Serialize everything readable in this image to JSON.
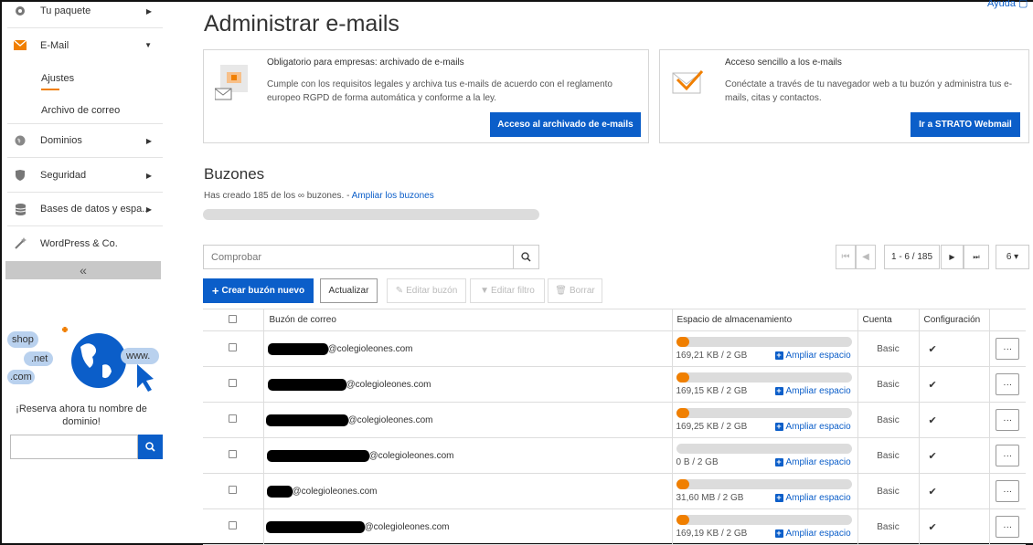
{
  "sidebar": {
    "items": [
      {
        "label": "Tu paquete",
        "icon": "package-icon"
      },
      {
        "label": "E-Mail",
        "icon": "envelope-icon"
      },
      {
        "label": "Dominios",
        "icon": "globe-icon"
      },
      {
        "label": "Seguridad",
        "icon": "shield-icon"
      },
      {
        "label": "Bases de datos y espa...",
        "icon": "database-icon"
      },
      {
        "label": "WordPress & Co.",
        "icon": "wand-icon"
      }
    ],
    "subitems": [
      "Ajustes",
      "Archivo de correo"
    ],
    "collapse_label": "«",
    "promo": {
      "text": "¡Reserva ahora tu nombre de dominio!",
      "bubble_1": "shop",
      "bubble_2": ".net",
      "bubble_3": ".com",
      "bubble_4": "www."
    }
  },
  "header": {
    "title": "Administrar e-mails",
    "help": "Ayuda"
  },
  "cards": [
    {
      "title": "Obligatorio para empresas: archivado de e-mails",
      "text": "Cumple con los requisitos legales y archiva tus e-mails de acuerdo con el reglamento europeo RGPD de forma automática y conforme a la ley.",
      "button": "Acceso al archivado de e-mails"
    },
    {
      "title": "Acceso sencillo a los e-mails",
      "text": "Conéctate a través de tu navegador web a tu buzón y administra tus e-mails, citas y contactos.",
      "button": "Ir a STRATO Webmail"
    }
  ],
  "mailboxes": {
    "title": "Buzones",
    "info": "Has creado 185 de los ∞ buzones. - ",
    "info_link": "Ampliar los buzones",
    "search_placeholder": "Comprobar",
    "pagination": {
      "first": "⏮",
      "prev": "◀",
      "range": "1 - 6 / 185",
      "next": "▶",
      "last": "⏭",
      "per_page": "6 ▾"
    },
    "toolbar": {
      "create": "Crear buzón nuevo",
      "update": "Actualizar",
      "edit": "Editar buzón",
      "filter": "Editar filtro",
      "delete": "Borrar"
    },
    "columns": {
      "mailbox": "Buzón de correo",
      "storage": "Espacio de almacenamiento",
      "account": "Cuenta",
      "config": "Configuración"
    },
    "expand_label": "Ampliar espacio",
    "rows": [
      {
        "domain": "@colegioleones.com",
        "storage": "169,21 KB / 2 GB",
        "usage": 0.02,
        "account": "Basic"
      },
      {
        "domain": "@colegioleones.com",
        "storage": "169,15 KB / 2 GB",
        "usage": 0.02,
        "account": "Basic"
      },
      {
        "domain": "@colegioleones.com",
        "storage": "169,25 KB / 2 GB",
        "usage": 0.02,
        "account": "Basic"
      },
      {
        "domain": "@colegioleones.com",
        "storage": "0 B / 2 GB",
        "usage": 0.0,
        "account": "Basic"
      },
      {
        "domain": "@colegioleones.com",
        "storage": "31,60 MB / 2 GB",
        "usage": 0.02,
        "account": "Basic"
      },
      {
        "domain": "@colegioleones.com",
        "storage": "169,19 KB / 2 GB",
        "usage": 0.02,
        "account": "Basic"
      }
    ]
  },
  "colors": {
    "accent": "#0b5ec9",
    "orange": "#f07f00"
  }
}
